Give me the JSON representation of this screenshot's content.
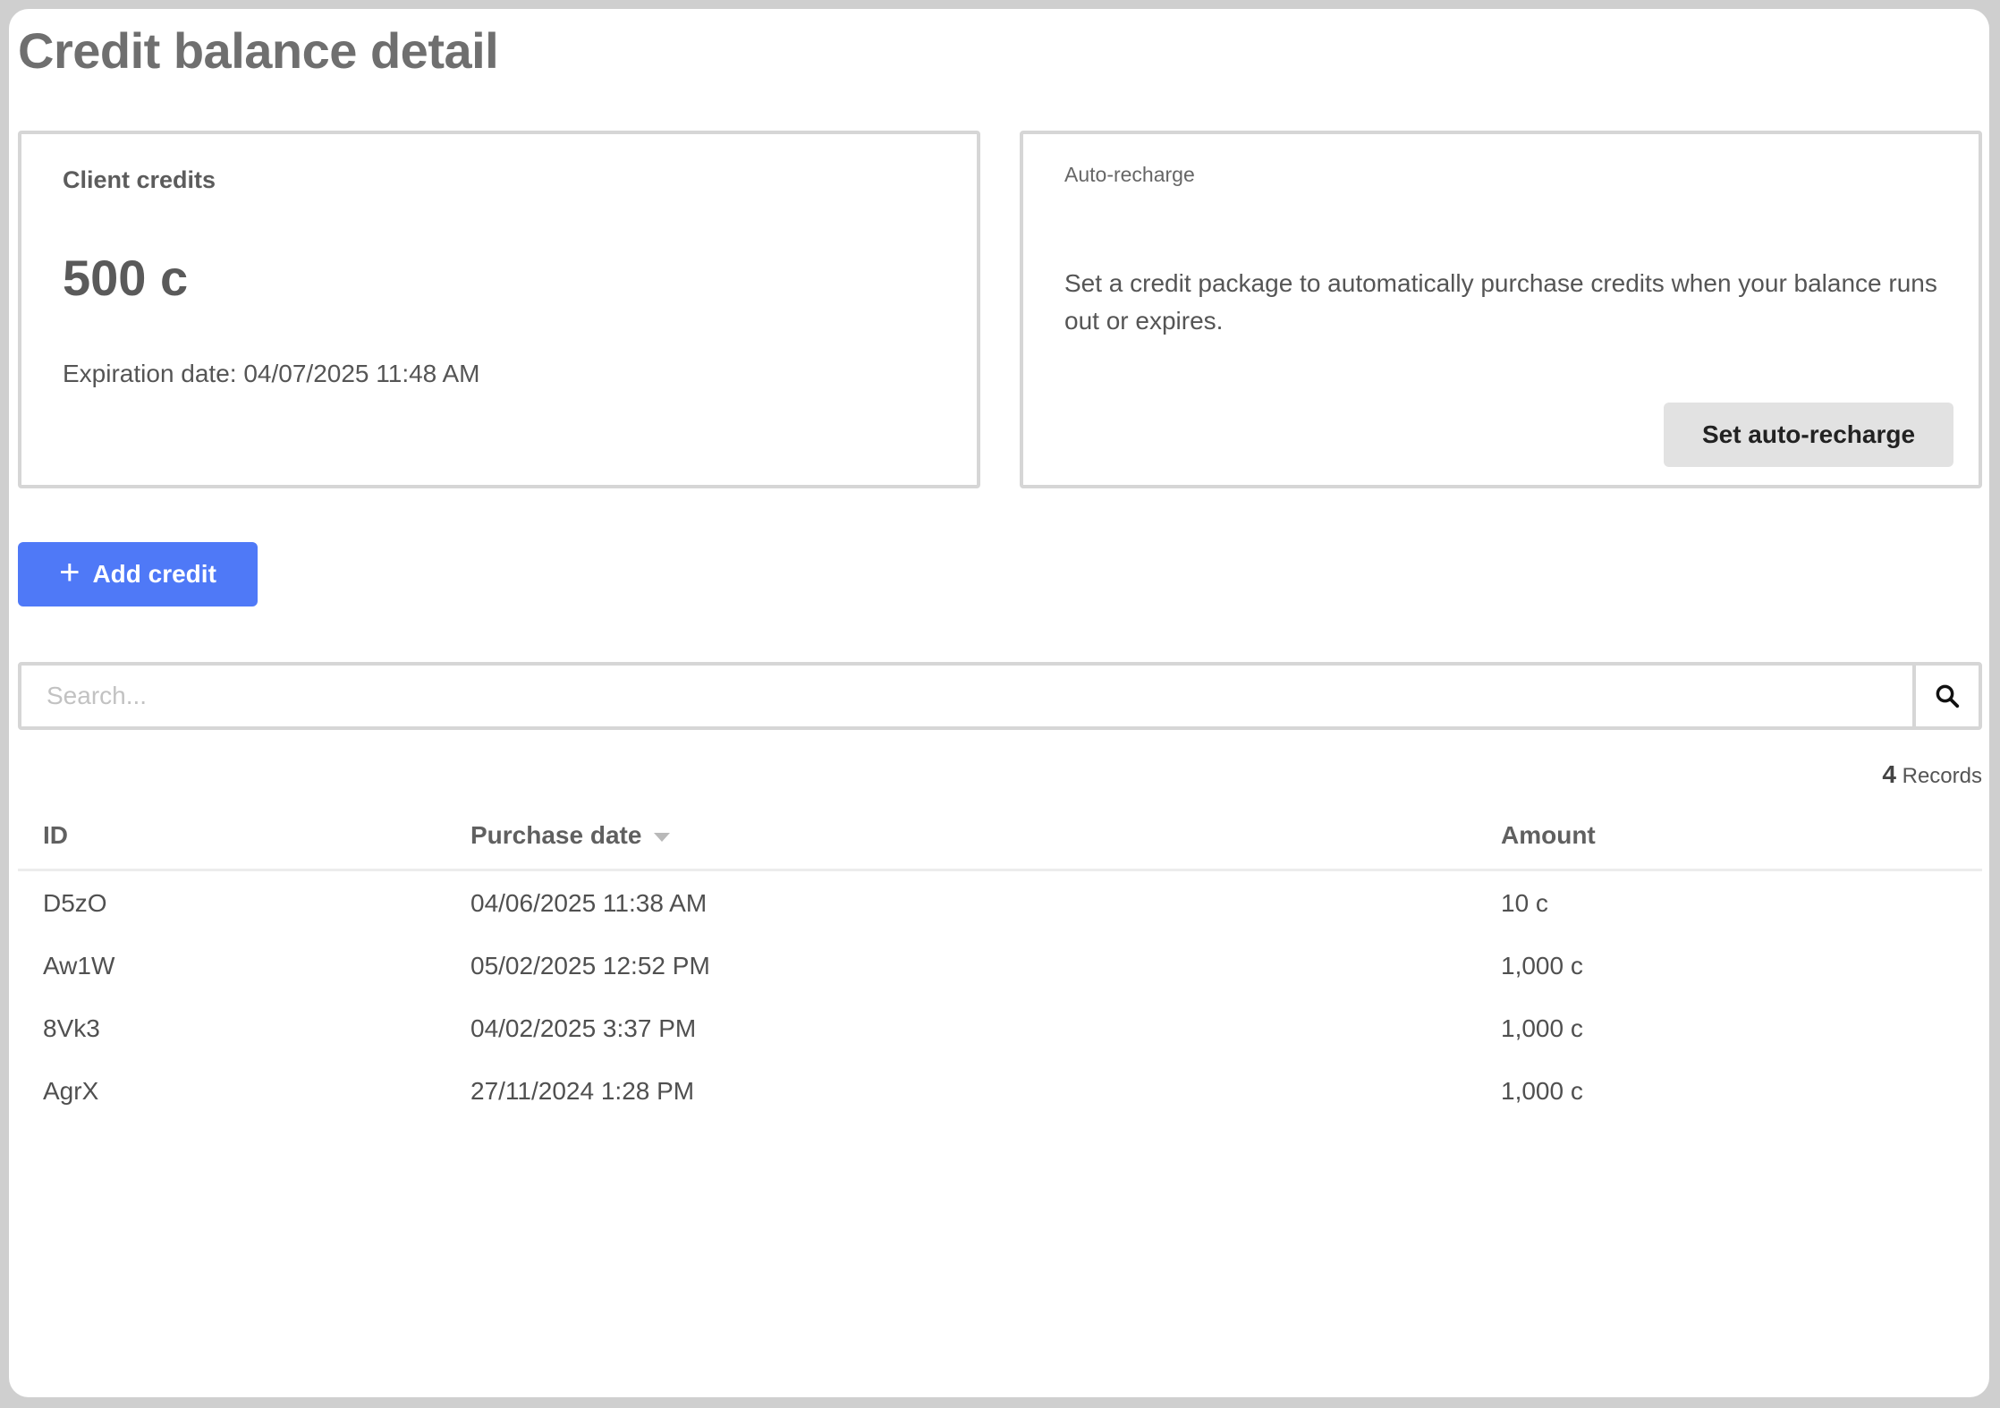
{
  "page": {
    "title": "Credit balance detail"
  },
  "credits_card": {
    "label": "Client credits",
    "value": "500 c",
    "expiration": "Expiration date: 04/07/2025 11:48 AM"
  },
  "auto_recharge_card": {
    "label": "Auto-recharge",
    "description": "Set a credit package to automatically purchase credits when your balance runs out or expires.",
    "button_label": "Set auto-recharge"
  },
  "add_credit": {
    "icon": "plus-icon",
    "label": "Add credit"
  },
  "search": {
    "placeholder": "Search...",
    "value": "",
    "icon": "search-icon"
  },
  "records": {
    "count": "4",
    "label": "Records"
  },
  "table": {
    "headers": {
      "id": "ID",
      "purchase_date": "Purchase date",
      "amount": "Amount"
    },
    "rows": [
      {
        "id": "D5zO",
        "purchase_date": "04/06/2025 11:38 AM",
        "amount": "10 c"
      },
      {
        "id": "Aw1W",
        "purchase_date": "05/02/2025 12:52 PM",
        "amount": "1,000 c"
      },
      {
        "id": "8Vk3",
        "purchase_date": "04/02/2025 3:37 PM",
        "amount": "1,000 c"
      },
      {
        "id": "AgrX",
        "purchase_date": "27/11/2024 1:28 PM",
        "amount": "1,000 c"
      }
    ]
  },
  "colors": {
    "primary": "#4f79f7",
    "secondary_button": "#e2e2e2",
    "border": "#d6d6d6"
  }
}
